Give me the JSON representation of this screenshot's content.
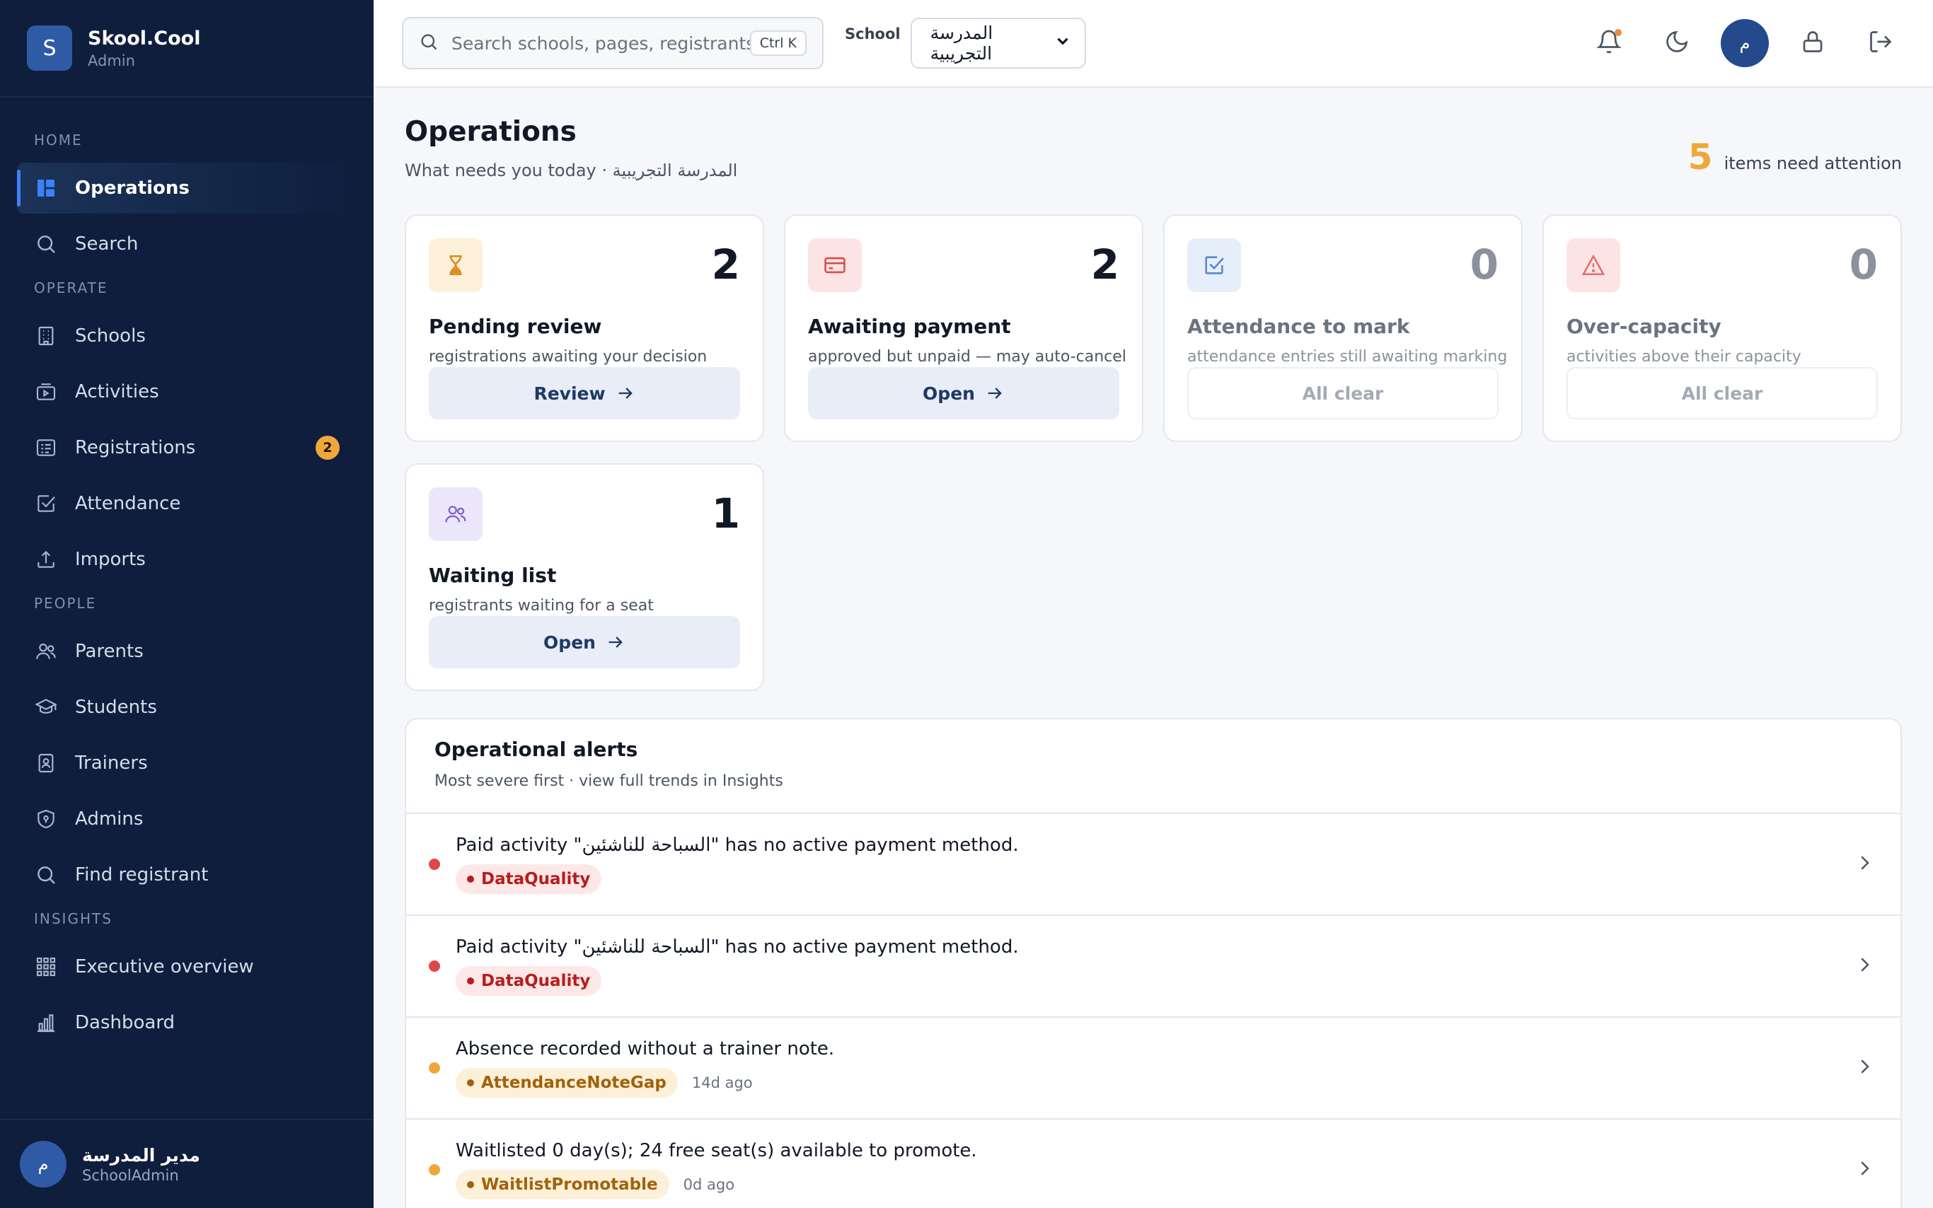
{
  "brand": {
    "logo_letter": "S",
    "name": "Skool.Cool",
    "role": "Admin"
  },
  "nav": {
    "groups": [
      {
        "label": "HOME",
        "items": [
          {
            "label": "Operations",
            "icon": "dashboard-icon",
            "active": true
          },
          {
            "label": "Search",
            "icon": "search-icon"
          }
        ]
      },
      {
        "label": "OPERATE",
        "items": [
          {
            "label": "Schools",
            "icon": "building-icon"
          },
          {
            "label": "Activities",
            "icon": "activity-icon"
          },
          {
            "label": "Registrations",
            "icon": "list-icon",
            "badge": "2"
          },
          {
            "label": "Attendance",
            "icon": "checkbox-icon"
          },
          {
            "label": "Imports",
            "icon": "upload-icon"
          }
        ]
      },
      {
        "label": "PEOPLE",
        "items": [
          {
            "label": "Parents",
            "icon": "users-icon"
          },
          {
            "label": "Students",
            "icon": "graduation-cap-icon"
          },
          {
            "label": "Trainers",
            "icon": "badge-icon"
          },
          {
            "label": "Admins",
            "icon": "shield-icon"
          },
          {
            "label": "Find registrant",
            "icon": "search-icon"
          }
        ]
      },
      {
        "label": "INSIGHTS",
        "items": [
          {
            "label": "Executive overview",
            "icon": "grid-icon"
          },
          {
            "label": "Dashboard",
            "icon": "bar-chart-icon"
          }
        ]
      }
    ]
  },
  "user": {
    "avatar": "م",
    "name": "مدير المدرسة",
    "role": "SchoolAdmin"
  },
  "topbar": {
    "search_placeholder": "Search schools, pages, registrants...",
    "shortcut": "Ctrl K",
    "school_label": "School",
    "school_value": "المدرسة التجريبية",
    "avatar": "م"
  },
  "page": {
    "title": "Operations",
    "subtitle": "What needs you today · المدرسة التجريبية",
    "attention_count": "5",
    "attention_label": "items need attention"
  },
  "cards": [
    {
      "icon": "hourglass-icon",
      "count": "2",
      "title": "Pending review",
      "desc": "registrations awaiting your decision",
      "button": "Review",
      "state": "action",
      "icon_bg": "#fdf0d8",
      "icon_color": "#d98a1c"
    },
    {
      "icon": "credit-card-icon",
      "count": "2",
      "title": "Awaiting payment",
      "desc": "approved but unpaid — may auto-cancel",
      "button": "Open",
      "state": "action",
      "icon_bg": "#fde4e4",
      "icon_color": "#dc4b4b"
    },
    {
      "icon": "check-square-icon",
      "count": "0",
      "title": "Attendance to mark",
      "desc": "attendance entries still awaiting marking",
      "button": "All clear",
      "state": "clear",
      "icon_bg": "#e6eef9",
      "icon_color": "#5a86c9"
    },
    {
      "icon": "warning-icon",
      "count": "0",
      "title": "Over-capacity",
      "desc": "activities above their capacity",
      "button": "All clear",
      "state": "clear",
      "icon_bg": "#fde4e4",
      "icon_color": "#e07070"
    },
    {
      "icon": "users-icon",
      "count": "1",
      "title": "Waiting list",
      "desc": "registrants waiting for a seat",
      "button": "Open",
      "state": "action",
      "icon_bg": "#ece6fa",
      "icon_color": "#7b5fc9"
    }
  ],
  "alerts": {
    "title": "Operational alerts",
    "subtitle": "Most severe first · view full trends in Insights",
    "items": [
      {
        "text": "Paid activity \"السباحة للناشئين\" has no active payment method.",
        "tag": "DataQuality",
        "severity": "red",
        "ago": ""
      },
      {
        "text": "Paid activity \"السباحة للناشئين\" has no active payment method.",
        "tag": "DataQuality",
        "severity": "red",
        "ago": ""
      },
      {
        "text": "Absence recorded without a trainer note.",
        "tag": "AttendanceNoteGap",
        "severity": "amber",
        "ago": "14d ago"
      },
      {
        "text": "Waitlisted 0 day(s); 24 free seat(s) available to promote.",
        "tag": "WaitlistPromotable",
        "severity": "amber",
        "ago": "0d ago"
      }
    ]
  },
  "colors": {
    "sidebar": "#0f1e3d",
    "accent": "#3b82f6",
    "attention": "#f0a73a",
    "severity_red": "#e04848",
    "severity_amber": "#f0a73a"
  }
}
